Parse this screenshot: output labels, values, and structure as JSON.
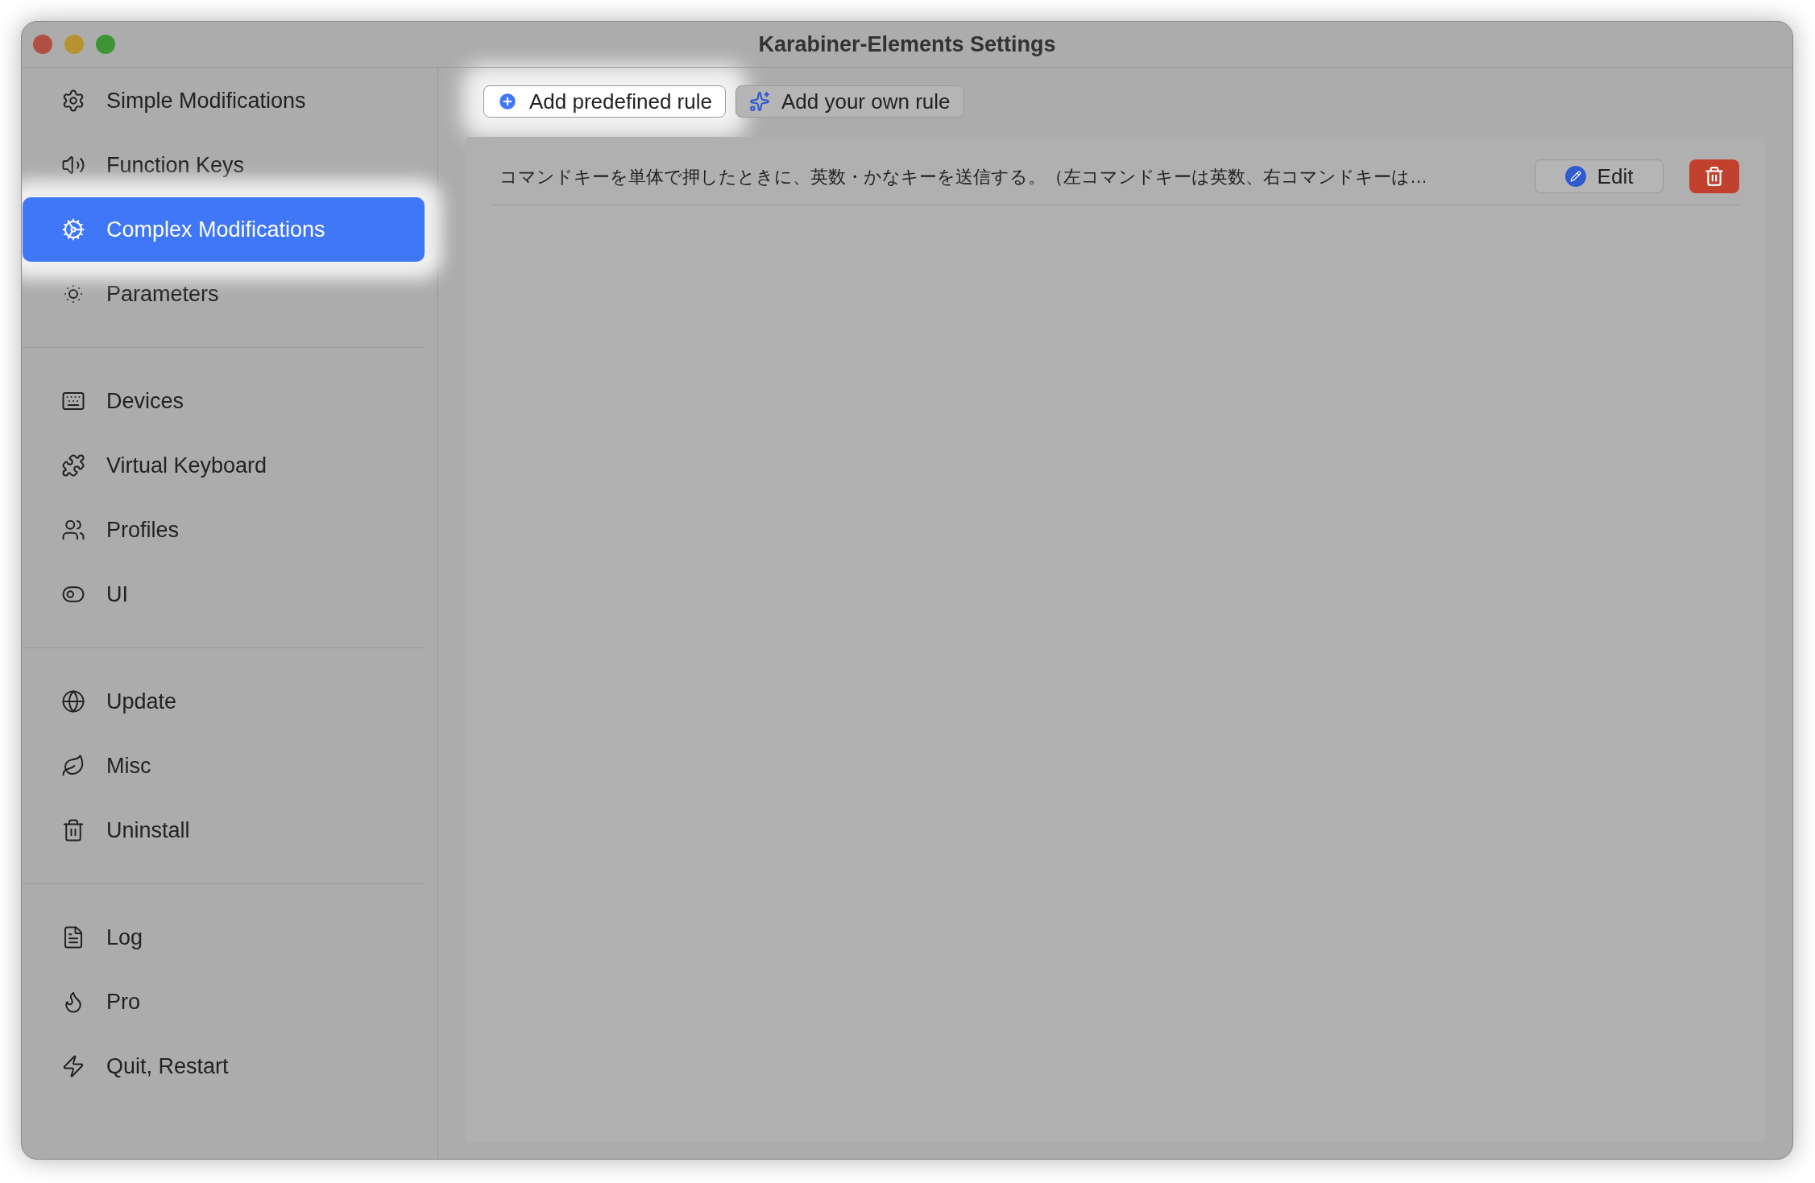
{
  "window": {
    "title": "Karabiner-Elements Settings"
  },
  "sidebar": {
    "groups": [
      [
        {
          "label": "Simple Modifications",
          "selected": false,
          "highlighted": false
        },
        {
          "label": "Function Keys",
          "selected": false,
          "highlighted": false
        },
        {
          "label": "Complex Modifications",
          "selected": true,
          "highlighted": true
        },
        {
          "label": "Parameters",
          "selected": false,
          "highlighted": false
        }
      ],
      [
        {
          "label": "Devices",
          "selected": false,
          "highlighted": false
        },
        {
          "label": "Virtual Keyboard",
          "selected": false,
          "highlighted": false
        },
        {
          "label": "Profiles",
          "selected": false,
          "highlighted": false
        },
        {
          "label": "UI",
          "selected": false,
          "highlighted": false
        }
      ],
      [
        {
          "label": "Update",
          "selected": false,
          "highlighted": false
        },
        {
          "label": "Misc",
          "selected": false,
          "highlighted": false
        },
        {
          "label": "Uninstall",
          "selected": false,
          "highlighted": false
        }
      ],
      [
        {
          "label": "Log",
          "selected": false,
          "highlighted": false
        },
        {
          "label": "Pro",
          "selected": false,
          "highlighted": false
        },
        {
          "label": "Quit, Restart",
          "selected": false,
          "highlighted": false
        }
      ]
    ]
  },
  "toolbar": [
    {
      "kind": "add",
      "label": "Add predefined rule",
      "highlighted": true
    },
    {
      "kind": "own",
      "label": "Add your own rule",
      "highlighted": false
    }
  ],
  "rules": [
    {
      "description": "コマンドキーを単体で押したときに、英数・かなキーを送信する。（左コマンドキーは英数、右コマンドキーは…",
      "edit_label": "Edit"
    }
  ]
}
